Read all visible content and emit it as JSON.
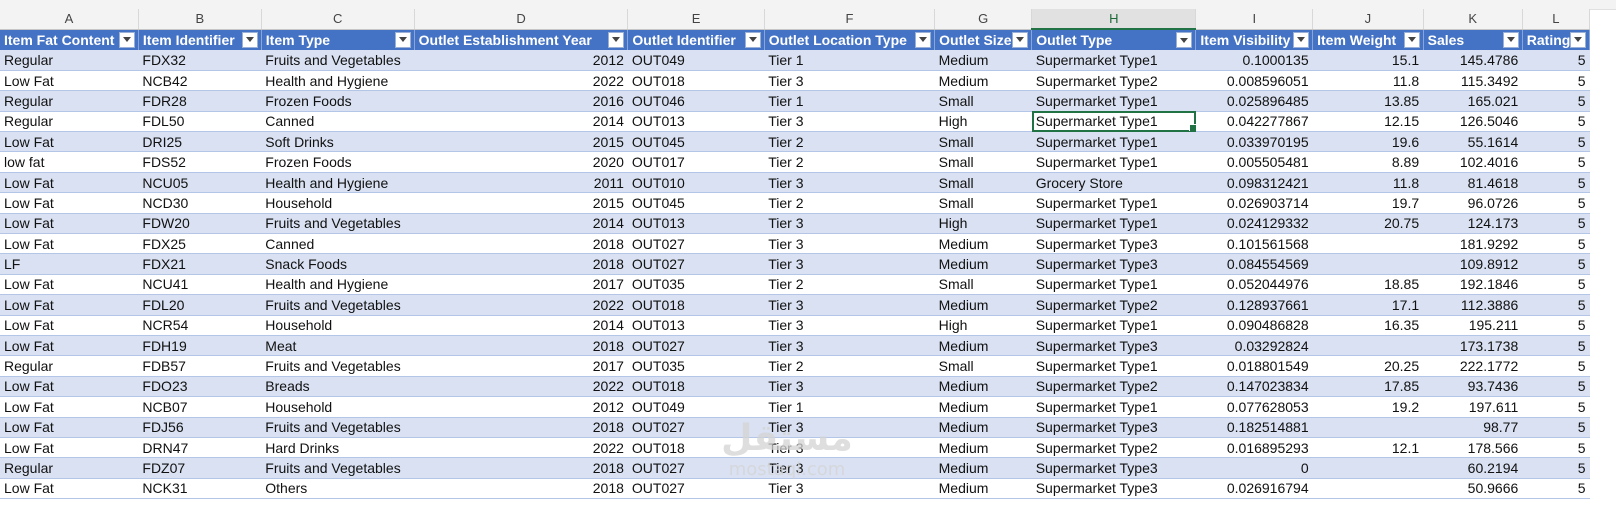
{
  "sheet": {
    "column_letters": [
      "A",
      "B",
      "C",
      "D",
      "E",
      "F",
      "G",
      "H",
      "I",
      "J",
      "K",
      "L"
    ],
    "headers": [
      "Item Fat Content",
      "Item Identifier",
      "Item Type",
      "Outlet Establishment Year",
      "Outlet Identifier",
      "Outlet Location Type",
      "Outlet Size",
      "Outlet Type",
      "Item Visibility",
      "Item Weight",
      "Sales",
      "Rating"
    ],
    "rows": [
      [
        "Regular",
        "FDX32",
        "Fruits and Vegetables",
        "2012",
        "OUT049",
        "Tier 1",
        "Medium",
        "Supermarket Type1",
        "0.1000135",
        "15.1",
        "145.4786",
        "5"
      ],
      [
        "Low Fat",
        "NCB42",
        "Health and Hygiene",
        "2022",
        "OUT018",
        "Tier 3",
        "Medium",
        "Supermarket Type2",
        "0.008596051",
        "11.8",
        "115.3492",
        "5"
      ],
      [
        "Regular",
        "FDR28",
        "Frozen Foods",
        "2016",
        "OUT046",
        "Tier 1",
        "Small",
        "Supermarket Type1",
        "0.025896485",
        "13.85",
        "165.021",
        "5"
      ],
      [
        "Regular",
        "FDL50",
        "Canned",
        "2014",
        "OUT013",
        "Tier 3",
        "High",
        "Supermarket Type1",
        "0.042277867",
        "12.15",
        "126.5046",
        "5"
      ],
      [
        "Low Fat",
        "DRI25",
        "Soft Drinks",
        "2015",
        "OUT045",
        "Tier 2",
        "Small",
        "Supermarket Type1",
        "0.033970195",
        "19.6",
        "55.1614",
        "5"
      ],
      [
        "low fat",
        "FDS52",
        "Frozen Foods",
        "2020",
        "OUT017",
        "Tier 2",
        "Small",
        "Supermarket Type1",
        "0.005505481",
        "8.89",
        "102.4016",
        "5"
      ],
      [
        "Low Fat",
        "NCU05",
        "Health and Hygiene",
        "2011",
        "OUT010",
        "Tier 3",
        "Small",
        "Grocery Store",
        "0.098312421",
        "11.8",
        "81.4618",
        "5"
      ],
      [
        "Low Fat",
        "NCD30",
        "Household",
        "2015",
        "OUT045",
        "Tier 2",
        "Small",
        "Supermarket Type1",
        "0.026903714",
        "19.7",
        "96.0726",
        "5"
      ],
      [
        "Low Fat",
        "FDW20",
        "Fruits and Vegetables",
        "2014",
        "OUT013",
        "Tier 3",
        "High",
        "Supermarket Type1",
        "0.024129332",
        "20.75",
        "124.173",
        "5"
      ],
      [
        "Low Fat",
        "FDX25",
        "Canned",
        "2018",
        "OUT027",
        "Tier 3",
        "Medium",
        "Supermarket Type3",
        "0.101561568",
        "",
        "181.9292",
        "5"
      ],
      [
        "LF",
        "FDX21",
        "Snack Foods",
        "2018",
        "OUT027",
        "Tier 3",
        "Medium",
        "Supermarket Type3",
        "0.084554569",
        "",
        "109.8912",
        "5"
      ],
      [
        "Low Fat",
        "NCU41",
        "Health and Hygiene",
        "2017",
        "OUT035",
        "Tier 2",
        "Small",
        "Supermarket Type1",
        "0.052044976",
        "18.85",
        "192.1846",
        "5"
      ],
      [
        "Low Fat",
        "FDL20",
        "Fruits and Vegetables",
        "2022",
        "OUT018",
        "Tier 3",
        "Medium",
        "Supermarket Type2",
        "0.128937661",
        "17.1",
        "112.3886",
        "5"
      ],
      [
        "Low Fat",
        "NCR54",
        "Household",
        "2014",
        "OUT013",
        "Tier 3",
        "High",
        "Supermarket Type1",
        "0.090486828",
        "16.35",
        "195.211",
        "5"
      ],
      [
        "Low Fat",
        "FDH19",
        "Meat",
        "2018",
        "OUT027",
        "Tier 3",
        "Medium",
        "Supermarket Type3",
        "0.03292824",
        "",
        "173.1738",
        "5"
      ],
      [
        "Regular",
        "FDB57",
        "Fruits and Vegetables",
        "2017",
        "OUT035",
        "Tier 2",
        "Small",
        "Supermarket Type1",
        "0.018801549",
        "20.25",
        "222.1772",
        "5"
      ],
      [
        "Low Fat",
        "FDO23",
        "Breads",
        "2022",
        "OUT018",
        "Tier 3",
        "Medium",
        "Supermarket Type2",
        "0.147023834",
        "17.85",
        "93.7436",
        "5"
      ],
      [
        "Low Fat",
        "NCB07",
        "Household",
        "2012",
        "OUT049",
        "Tier 1",
        "Medium",
        "Supermarket Type1",
        "0.077628053",
        "19.2",
        "197.611",
        "5"
      ],
      [
        "Low Fat",
        "FDJ56",
        "Fruits and Vegetables",
        "2018",
        "OUT027",
        "Tier 3",
        "Medium",
        "Supermarket Type3",
        "0.182514881",
        "",
        "98.77",
        "5"
      ],
      [
        "Low Fat",
        "DRN47",
        "Hard Drinks",
        "2022",
        "OUT018",
        "Tier 3",
        "Medium",
        "Supermarket Type2",
        "0.016895293",
        "12.1",
        "178.566",
        "5"
      ],
      [
        "Regular",
        "FDZ07",
        "Fruits and Vegetables",
        "2018",
        "OUT027",
        "Tier 3",
        "Medium",
        "Supermarket Type3",
        "0",
        "",
        "60.2194",
        "5"
      ],
      [
        "Low Fat",
        "NCK31",
        "Others",
        "2018",
        "OUT027",
        "Tier 3",
        "Medium",
        "Supermarket Type3",
        "0.026916794",
        "",
        "50.9666",
        "5"
      ]
    ],
    "numeric_columns": [
      3,
      8,
      9,
      10,
      11
    ],
    "selected_column": 7,
    "active_cell": {
      "row": 3,
      "col": 7
    }
  },
  "watermark": {
    "main": "مستقل",
    "sub": "mostaql.com"
  },
  "icons": {
    "filter": "filter-dropdown-arrow-icon"
  },
  "colors": {
    "header_bg": "#4472c4",
    "band_row": "#d9e1f2",
    "active_border": "#217346"
  }
}
